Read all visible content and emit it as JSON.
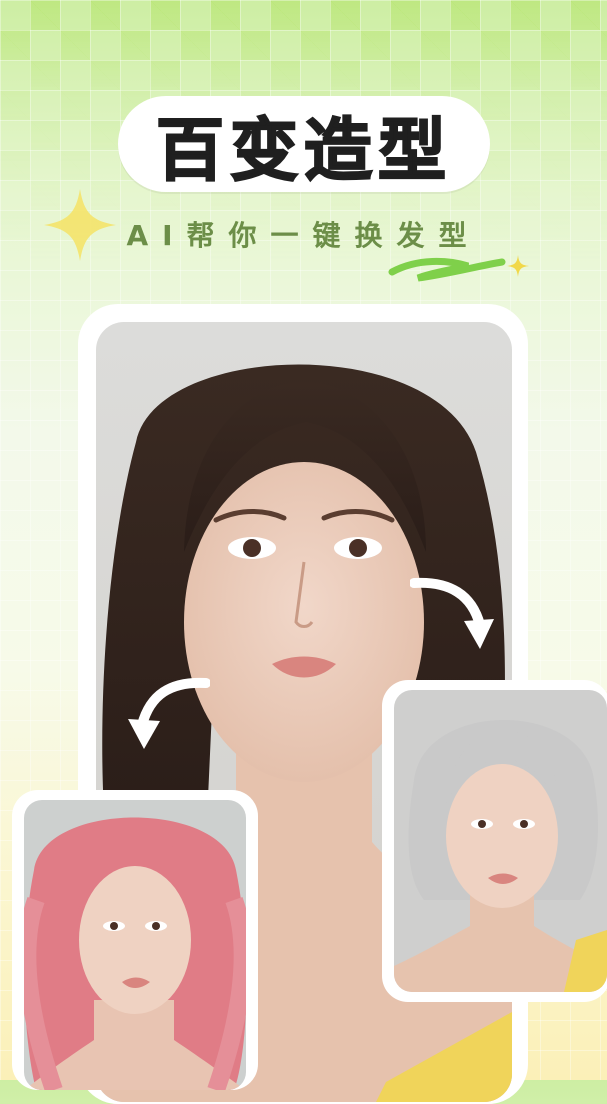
{
  "promo": {
    "title": "百变造型",
    "subtitle": "AI帮你一键换发型"
  },
  "images": {
    "main": {
      "hair_color": "#3a2a22",
      "description_icon": "portrait-original"
    },
    "left_card": {
      "hair_color": "#e07c86",
      "description_icon": "portrait-pink-hair"
    },
    "right_card": {
      "hair_color": "#c9c9c9",
      "description_icon": "portrait-silver-hair"
    }
  },
  "colors": {
    "accent_green": "#a7d86a",
    "subtitle_green": "#6c8e48",
    "star_yellow": "#f4e36a"
  }
}
